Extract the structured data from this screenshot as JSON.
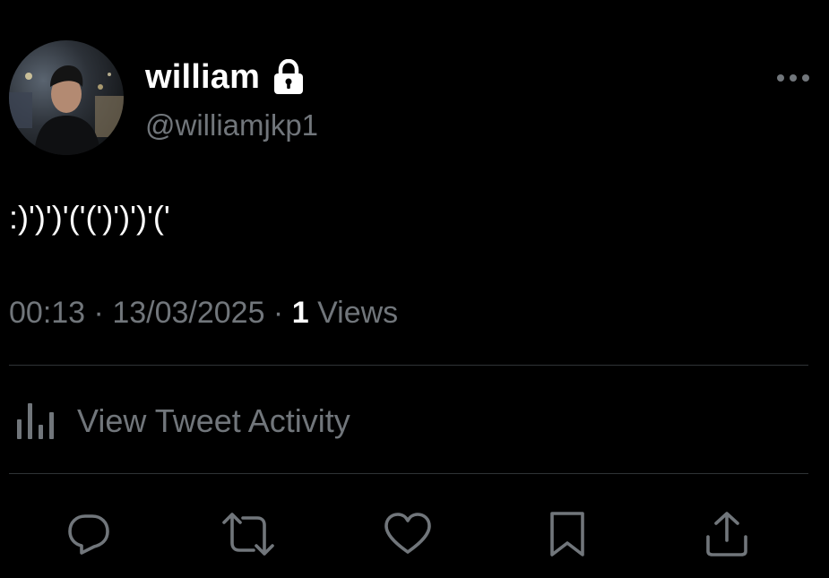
{
  "tweet": {
    "display_name": "william",
    "handle": "@williamjkp1",
    "protected_icon": "lock-icon",
    "more_icon": "more-horizontal-icon",
    "text": ":)')')'('(')')')'('",
    "time": "00:13",
    "separator": " · ",
    "date": "13/03/2025",
    "views_count": "1",
    "views_label": " Views"
  },
  "activity": {
    "icon": "bar-chart-icon",
    "label": "View Tweet Activity"
  },
  "actions": [
    {
      "name": "reply",
      "icon": "reply-icon"
    },
    {
      "name": "retweet",
      "icon": "retweet-icon"
    },
    {
      "name": "like",
      "icon": "heart-icon"
    },
    {
      "name": "bookmark",
      "icon": "bookmark-icon"
    },
    {
      "name": "share",
      "icon": "share-icon"
    }
  ],
  "colors": {
    "background": "#000000",
    "primary_text": "#ffffff",
    "secondary_text": "#71767b",
    "divider": "#2f3336",
    "icon": "#71767b"
  }
}
